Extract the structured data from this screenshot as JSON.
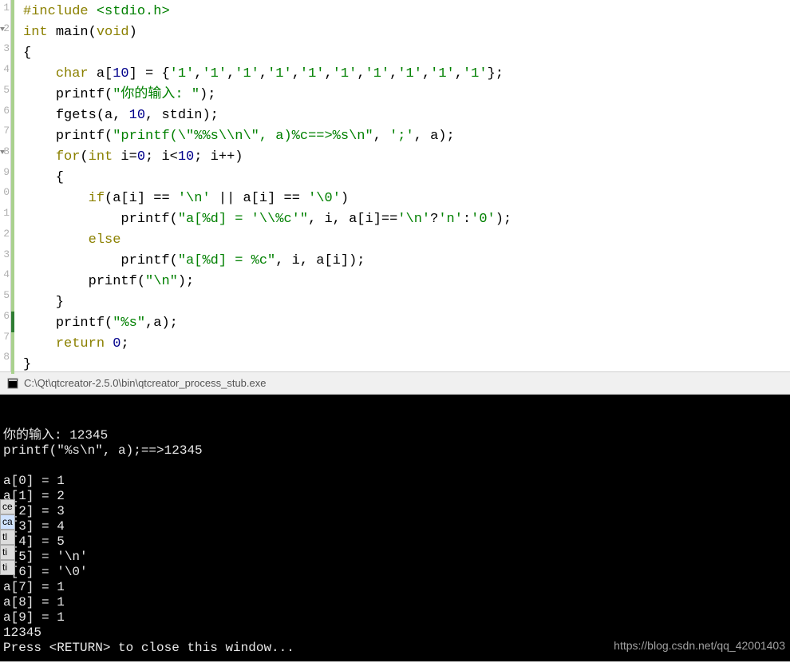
{
  "editor": {
    "gutter": [
      {
        "num": "1",
        "fold": false,
        "mark": "green"
      },
      {
        "num": "2",
        "fold": true,
        "mark": "green"
      },
      {
        "num": "3",
        "fold": false,
        "mark": "green"
      },
      {
        "num": "4",
        "fold": false,
        "mark": "green"
      },
      {
        "num": "5",
        "fold": false,
        "mark": "green"
      },
      {
        "num": "6",
        "fold": false,
        "mark": "green"
      },
      {
        "num": "7",
        "fold": false,
        "mark": "green"
      },
      {
        "num": "8",
        "fold": true,
        "mark": "green"
      },
      {
        "num": "9",
        "fold": false,
        "mark": "green"
      },
      {
        "num": "0",
        "fold": false,
        "mark": "green"
      },
      {
        "num": "1",
        "fold": false,
        "mark": "green"
      },
      {
        "num": "2",
        "fold": false,
        "mark": "green"
      },
      {
        "num": "3",
        "fold": false,
        "mark": "green"
      },
      {
        "num": "4",
        "fold": false,
        "mark": "green"
      },
      {
        "num": "5",
        "fold": false,
        "mark": "green"
      },
      {
        "num": "6",
        "fold": false,
        "mark": "dark"
      },
      {
        "num": "7",
        "fold": false,
        "mark": "green"
      },
      {
        "num": "8",
        "fold": false,
        "mark": "green"
      }
    ],
    "code": {
      "l1": {
        "a": "#include",
        "b": "<stdio.h>"
      },
      "l2": {
        "a": "int",
        "b": "main",
        "c": "void"
      },
      "l3": "{",
      "l4": {
        "a": "char",
        "b": "a[",
        "c": "10",
        "d": "] = {",
        "e": "'1'",
        "f": "};"
      },
      "l5": {
        "a": "printf(",
        "b": "\"你的输入: \"",
        "c": ");"
      },
      "l6": {
        "a": "fgets(a, ",
        "b": "10",
        "c": ", stdin);"
      },
      "l7": {
        "a": "printf(",
        "b": "\"printf(\\\"%%s\\\\n\\\", a)%c==>%s\\n\"",
        "c": ", ",
        "d": "';'",
        "e": ", a);"
      },
      "l8": {
        "a": "for",
        "b": "(",
        "c": "int",
        "d": " i=",
        "e": "0",
        "f": "; i<",
        "g": "10",
        "h": "; i++)"
      },
      "l9": "{",
      "l10": {
        "a": "if",
        "b": "(a[i] == ",
        "c": "'\\n'",
        "d": " || a[i] == ",
        "e": "'\\0'",
        "f": ")"
      },
      "l11": {
        "a": "printf(",
        "b": "\"a[%d] = '\\\\%c'\"",
        "c": ", i, a[i]==",
        "d": "'\\n'",
        "e": "?",
        "f": "'n'",
        "g": ":",
        "h": "'0'",
        "i": ");"
      },
      "l12": {
        "a": "else"
      },
      "l13": {
        "a": "printf(",
        "b": "\"a[%d] = %c\"",
        "c": ", i, a[i]);"
      },
      "l14": {
        "a": "printf(",
        "b": "\"\\n\"",
        "c": ");"
      },
      "l15": "}",
      "l16": {
        "a": "printf(",
        "b": "\"%s\"",
        "c": ",a);"
      },
      "l17": {
        "a": "return",
        "b": "0",
        "c": ";"
      },
      "l18": "}"
    }
  },
  "titlebar": {
    "path": "C:\\Qt\\qtcreator-2.5.0\\bin\\qtcreator_process_stub.exe"
  },
  "console": {
    "lines": [
      "你的输入: 12345",
      "printf(\"%s\\n\", a);==>12345",
      "",
      "a[0] = 1",
      "a[1] = 2",
      "a[2] = 3",
      "a[3] = 4",
      "a[4] = 5",
      "a[5] = '\\n'",
      "a[6] = '\\0'",
      "a[7] = 1",
      "a[8] = 1",
      "a[9] = 1",
      "12345",
      "Press <RETURN> to close this window..."
    ]
  },
  "watermark": "https://blog.csdn.net/qq_42001403",
  "left_floats": [
    "ce",
    "ca",
    "tl",
    "ti",
    "ti"
  ]
}
